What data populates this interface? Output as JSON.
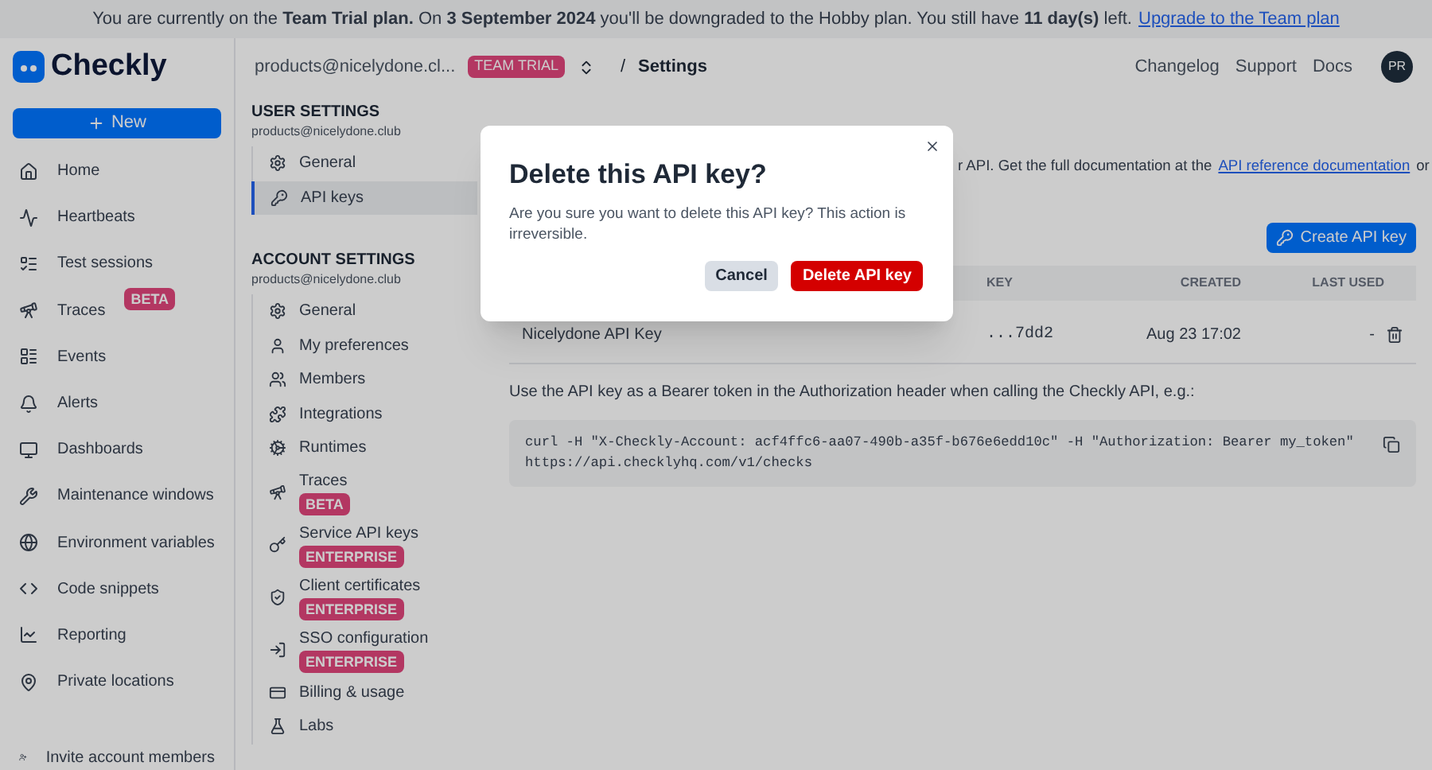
{
  "banner": {
    "text": "You are currently on the **Team Trial plan.** On **3 September 2024** you'll be downgraded to the Hobby plan. You still have **11 day(s)** left.",
    "link": "Upgrade to the Team plan"
  },
  "header": {
    "logo": "Checkly",
    "account": "products@nicelydone.cl...",
    "plan_badge": "TEAM TRIAL",
    "breadcrumb_separator": "/",
    "page": "Settings",
    "links": [
      "Changelog",
      "Support",
      "Docs"
    ],
    "avatar": "PR"
  },
  "sidebar": {
    "new_button": "New",
    "items": [
      {
        "label": "Home"
      },
      {
        "label": "Heartbeats"
      },
      {
        "label": "Test sessions"
      },
      {
        "label": "Traces",
        "badge": "BETA"
      },
      {
        "label": "Events"
      },
      {
        "label": "Alerts"
      },
      {
        "label": "Dashboards"
      },
      {
        "label": "Maintenance windows"
      },
      {
        "label": "Environment variables"
      },
      {
        "label": "Code snippets"
      },
      {
        "label": "Reporting"
      },
      {
        "label": "Private locations"
      }
    ],
    "footer": "Invite account members"
  },
  "settings_nav": {
    "sections": [
      {
        "title": "USER SETTINGS",
        "subtitle": "products@nicelydone.club",
        "items": [
          {
            "label": "General",
            "selected": false
          },
          {
            "label": "API keys",
            "selected": true
          }
        ]
      },
      {
        "title": "ACCOUNT SETTINGS",
        "subtitle": "products@nicelydone.club",
        "items": [
          {
            "label": "General",
            "selected": false
          },
          {
            "label": "My preferences",
            "selected": false
          },
          {
            "label": "Members",
            "selected": false
          },
          {
            "label": "Integrations",
            "selected": false
          },
          {
            "label": "Runtimes",
            "selected": false
          },
          {
            "label": "Traces",
            "badge": "BETA",
            "selected": false
          },
          {
            "label": "Service API keys",
            "badge": "ENTERPRISE",
            "selected": false
          },
          {
            "label": "Client certificates",
            "badge": "ENTERPRISE",
            "selected": false
          },
          {
            "label": "SSO configuration",
            "badge": "ENTERPRISE",
            "selected": false
          },
          {
            "label": "Billing & usage",
            "selected": false
          },
          {
            "label": "Labs",
            "selected": false
          }
        ]
      }
    ]
  },
  "main": {
    "intro": "r API. Get the full documentation at the",
    "intro_link": "API reference documentation",
    "intro_end": "or",
    "create_button": "Create API key",
    "table": {
      "columns": [
        "KEY",
        "CREATED",
        "LAST USED"
      ],
      "rows": [
        {
          "name": "Nicelydone API Key",
          "key": "...7dd2",
          "created": "Aug 23 17:02",
          "last_used": "-"
        }
      ]
    },
    "usage": "Use the API key as a Bearer token in the Authorization header when calling the Checkly API, e.g.:",
    "code": [
      "curl -H \"X-Checkly-Account: acf4ffc6-aa07-490b-a35f-b676e6edd10c\" -H \"Authorization: Bearer my_token\"",
      "https://api.checklyhq.com/v1/checks"
    ]
  },
  "dialog": {
    "title": "Delete this API key?",
    "message": "Are you sure you want to delete this API key? This action is irreversible.",
    "buttons": [
      "Cancel",
      "Delete API key"
    ]
  }
}
